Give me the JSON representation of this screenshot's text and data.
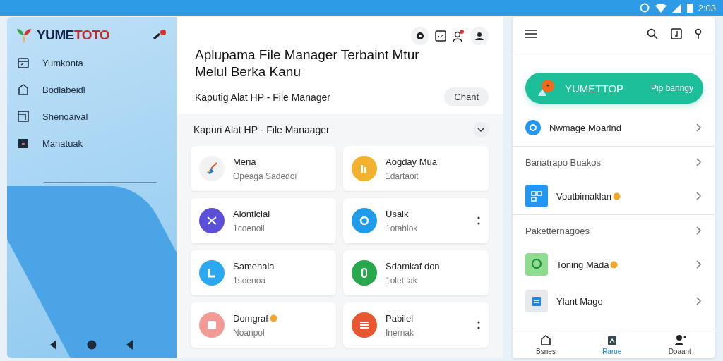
{
  "status_bar": {
    "time": "2:03"
  },
  "sidebar": {
    "logo": {
      "first": "YUME",
      "second": "TOTO"
    },
    "items": [
      {
        "label": "Yumkonta"
      },
      {
        "label": "Bodlabeidl"
      },
      {
        "label": "Shenoaival"
      },
      {
        "label": "Manatuak"
      }
    ]
  },
  "main": {
    "title": "Aplupama File Manager Terbaint Mtur Melul Berka Kanu",
    "subtitle": "Kaputig Alat HP - File Manager",
    "action": "Chant",
    "section": {
      "title": "Kapuri Alat HP - File Manaager",
      "expanded": true
    },
    "cards": [
      {
        "title": "Meria",
        "subtitle": "Opeaga Sadedoi",
        "color": "#f2f2f2",
        "menu": false,
        "badge": false
      },
      {
        "title": "Aogday Mua",
        "subtitle": "1dartaoit",
        "color": "#f2b22e",
        "menu": false,
        "badge": false
      },
      {
        "title": "Alonticlai",
        "subtitle": "1coenoil",
        "color": "#5b4fd8",
        "menu": false,
        "badge": false
      },
      {
        "title": "Usaik",
        "subtitle": "1otahiok",
        "color": "#1e9be9",
        "menu": true,
        "badge": false
      },
      {
        "title": "Samenala",
        "subtitle": "1soenoa",
        "color": "#2aa8f2",
        "menu": false,
        "badge": false
      },
      {
        "title": "Sdamkaf don",
        "subtitle": "1olet lak",
        "color": "#28a84c",
        "menu": false,
        "badge": false
      },
      {
        "title": "Domgraf",
        "subtitle": "Noanpol",
        "color": "#f49a95",
        "menu": false,
        "badge": true
      },
      {
        "title": "Pabilel",
        "subtitle": "Inernak",
        "color": "#e8572f",
        "menu": true,
        "badge": false
      }
    ]
  },
  "right_panel": {
    "promo": {
      "title": "YUMETTOP",
      "action": "Pip banngy"
    },
    "rows": [
      {
        "kind": "item",
        "label": "Nwmage Moarind",
        "color": "#2196f3",
        "badge": false
      },
      {
        "kind": "header",
        "label": "Banatrapo Buakos"
      },
      {
        "kind": "item",
        "label": "Voutbimaklan",
        "color": "#2196f3",
        "badge": true
      },
      {
        "kind": "header",
        "label": "Paketternagoes"
      },
      {
        "kind": "item",
        "label": "Toning Mada",
        "color": "#8fdc8f",
        "badge": true
      },
      {
        "kind": "item",
        "label": "Ylant Mage",
        "color": "#e6eaee",
        "badge": false
      }
    ],
    "nav": [
      {
        "label": "Bsnes",
        "selected": false
      },
      {
        "label": "Rarue",
        "selected": true
      },
      {
        "label": "Doaant",
        "selected": false
      }
    ]
  }
}
